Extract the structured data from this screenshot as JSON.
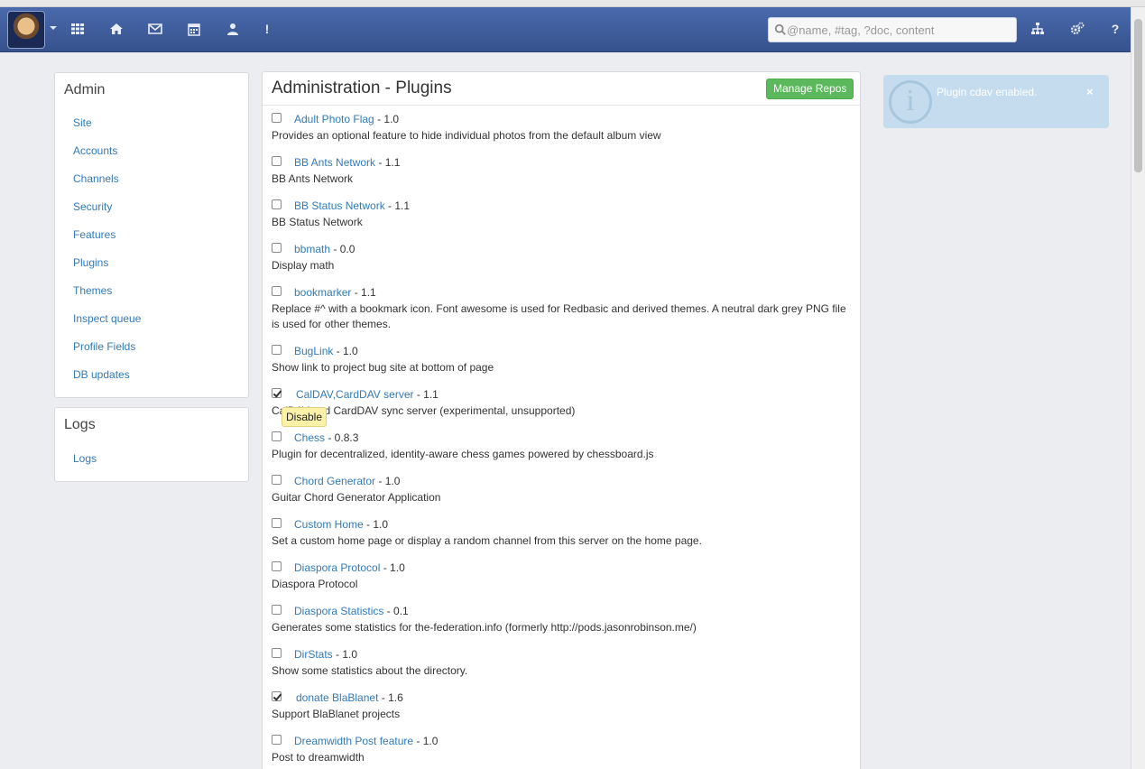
{
  "navbar": {
    "search_placeholder": "@name, #tag, ?doc, content",
    "help_label": "?",
    "alert_label": "!"
  },
  "admin": {
    "title": "Admin",
    "links": [
      "Site",
      "Accounts",
      "Channels",
      "Security",
      "Features",
      "Plugins",
      "Themes",
      "Inspect queue",
      "Profile Fields",
      "DB updates"
    ]
  },
  "logs": {
    "title": "Logs",
    "links": [
      "Logs"
    ]
  },
  "main": {
    "title": "Administration - Plugins",
    "manage_repos_label": "Manage Repos",
    "tooltip": "Disable",
    "plugins": [
      {
        "name": "Adult Photo Flag",
        "version": " - 1.0",
        "desc": "Provides an optional feature to hide individual photos from the default album view",
        "checked": false
      },
      {
        "name": "BB Ants Network",
        "version": " - 1.1",
        "desc": "BB Ants Network",
        "checked": false
      },
      {
        "name": "BB Status Network",
        "version": " - 1.1",
        "desc": "BB Status Network",
        "checked": false
      },
      {
        "name": "bbmath",
        "version": " - 0.0",
        "desc": "Display math",
        "checked": false
      },
      {
        "name": "bookmarker",
        "version": " - 1.1",
        "desc": "Replace #^ with a bookmark icon. Font awesome is used for Redbasic and derived themes. A neutral dark grey PNG file is used for other themes.",
        "checked": false
      },
      {
        "name": "BugLink",
        "version": " - 1.0",
        "desc": "Show link to project bug site at bottom of page",
        "checked": false
      },
      {
        "name": "CalDAV,CardDAV server",
        "version": " - 1.1",
        "desc": "CalDAV and CardDAV sync server (experimental, unsupported)",
        "checked": true
      },
      {
        "name": "Chess",
        "version": " - 0.8.3",
        "desc": "Plugin for decentralized, identity-aware chess games powered by chessboard.js",
        "checked": false
      },
      {
        "name": "Chord Generator",
        "version": " - 1.0",
        "desc": "Guitar Chord Generator Application",
        "checked": false
      },
      {
        "name": "Custom Home",
        "version": " - 1.0",
        "desc": "Set a custom home page or display a random channel from this server on the home page.",
        "checked": false
      },
      {
        "name": "Diaspora Protocol",
        "version": " - 1.0",
        "desc": "Diaspora Protocol",
        "checked": false
      },
      {
        "name": "Diaspora Statistics",
        "version": " - 0.1",
        "desc": "Generates some statistics for the-federation.info (formerly http://pods.jasonrobinson.me/)",
        "checked": false
      },
      {
        "name": "DirStats",
        "version": " - 1.0",
        "desc": "Show some statistics about the directory.",
        "checked": false
      },
      {
        "name": "donate BlaBlanet",
        "version": " - 1.6",
        "desc": "Support BlaBlanet projects",
        "checked": true
      },
      {
        "name": "Dreamwidth Post feature",
        "version": " - 1.0",
        "desc": "Post to dreamwidth",
        "checked": false
      }
    ]
  },
  "notification": {
    "text": "Plugin cdav enabled.",
    "close_label": "×"
  }
}
